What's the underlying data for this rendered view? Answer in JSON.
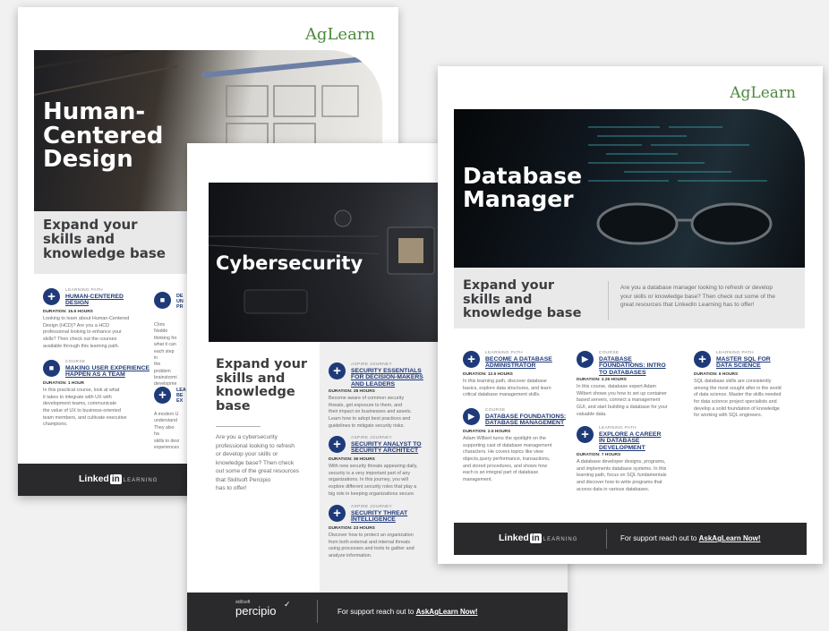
{
  "sheets": {
    "hcd": {
      "brand": "AgLearn",
      "title_lines": [
        "Human-",
        "Centered",
        "Design"
      ],
      "tagline_lines": [
        "Expand your",
        "skills and",
        "knowledge base"
      ],
      "courses": [
        {
          "type": "LEARNING PATH",
          "title_lines": [
            "HUMAN-CENTERED",
            "DESIGN"
          ],
          "duration": "DURATION: 15.5 HOURS",
          "desc_lines": [
            "Looking to learn about Human-Centered",
            "Design (HCD)? Are you a HCD",
            "professional looking to enhance your",
            "skills? Then check out the courses",
            "available through this learning path."
          ]
        },
        {
          "type": "COURSE",
          "title_lines": [
            "MAKING USER EXPERIENCE",
            "HAPPEN AS A TEAM"
          ],
          "duration": "DURATION: 1 HOUR",
          "desc_lines": [
            "In this practical course, look at what",
            "it takes to integrate with UX with",
            "development teams, communicate",
            "the value of UX to business-oriented",
            "team members, and cultivate executive",
            "champions."
          ]
        }
      ],
      "partial_col": {
        "title_lines": [
          "DE",
          "UN",
          "PR"
        ],
        "desc_lines": [
          "Chris Nodde",
          "thinking fro",
          "what it can",
          "each step in",
          "the problem",
          "brainstormi",
          "developme"
        ],
        "title2_lines": [
          "LEA",
          "BE",
          "EX"
        ],
        "desc2_lines": [
          "A modern U",
          "understand",
          "They also ha",
          "skills to desi",
          "experiences"
        ]
      },
      "footer": {
        "linkedin": "Linked",
        "in": "in",
        "learning": "LEARNING"
      }
    },
    "cyber": {
      "title": "Cybersecurity",
      "tagline_lines": [
        "Expand your",
        "skills and",
        "knowledge",
        "base"
      ],
      "intro_lines": [
        "Are you a cybersecurity",
        "professional looking to refresh",
        "or develop your skills or",
        "knowledge base? Then check",
        "out some of the great resources",
        "that Skillsoft Percipio",
        "has to offer!"
      ],
      "courses": [
        {
          "type": "ASPIRE JOURNEY",
          "title_lines": [
            "SECURITY ESSENTIALS",
            "FOR DECISION-MAKERS",
            "AND LEADERS"
          ],
          "duration": "DURATION: 28 HOURS",
          "desc_lines": [
            "Become aware of common security",
            "threats, get exposure to them, and",
            "their impact on businesses and assets.",
            "Learn how to adopt best practices and",
            "guidelines to mitigate security risks."
          ]
        },
        {
          "type": "ASPIRE JOURNEY",
          "title_lines": [
            "SECURITY ANALYST TO",
            "SECURITY ARCHITECT"
          ],
          "duration": "DURATION: 36 HOURS",
          "desc_lines": [
            "With new security threats appearing daily,",
            "security is a very important part of any",
            "organizations. In this journey, you will",
            "explore different security roles that play a",
            "big role in keeping organizations secure."
          ]
        },
        {
          "type": "ASPIRE JOURNEY",
          "title_lines": [
            "SECURITY THREAT",
            "INTELLIGENCE"
          ],
          "duration": "DURATION: 23 HOURS",
          "desc_lines": [
            "Discover how to protect an organization",
            "from both external and internal threats",
            "using processes and tools to gather and",
            "analyze information."
          ]
        }
      ],
      "footer": {
        "skillsoft": "skillsoft",
        "percipio": "percipio",
        "support_prefix": "For support reach out to ",
        "support_link": "AskAgLearn Now!"
      }
    },
    "db": {
      "brand": "AgLearn",
      "title_lines": [
        "Database",
        "Manager"
      ],
      "tagline_lines": [
        "Expand your",
        "skills and",
        "knowledge base"
      ],
      "intro_lines": [
        "Are you a database manager looking to refresh or develop",
        "your skills or knowledge base? Then check out some of the",
        "great resources that LinkedIn Learning has to offer!"
      ],
      "courses": [
        {
          "type": "LEARNING PATH",
          "title_lines": [
            "BECOME A DATABASE",
            "ADMINISTRATOR"
          ],
          "duration": "DURATION: 12.5 HOURS",
          "desc_lines": [
            "In this learning path, discover database",
            "basics, explore data structures, and learn",
            "critical database management skills."
          ]
        },
        {
          "type": "COURSE",
          "title_lines": [
            "DATABASE FOUNDATIONS:",
            "DATABASE MANAGEMENT"
          ],
          "duration": "DURATION: 2.5 HOURS",
          "desc_lines": [
            "Adam Wilbert turns the spotlight on the",
            "supporting cast of database management",
            "characters. He covers topics like view",
            "objects,query performance, transactions,",
            "and stored procedures, and shows how",
            "each is an integral part of database",
            "management."
          ]
        },
        {
          "type": "COURSE",
          "title_lines": [
            "DATABASE",
            "FOUNDATIONS: INTRO",
            "TO DATABASES"
          ],
          "duration": "DURATION: 2.25 HOURS",
          "desc_lines": [
            "In this course, database expert Adam",
            "Wilbert shows you how to set up container",
            "based servers, connect a management",
            "GUI, and start building a database for your",
            "valuable data."
          ]
        },
        {
          "type": "LEARNING PATH",
          "title_lines": [
            "EXPLORE A CAREER",
            "IN DATABASE",
            "DEVELOPMENT"
          ],
          "duration": "DURATION: 7 HOURS",
          "desc_lines": [
            "A database developer designs, programs,",
            "and implements database systems. In this",
            "learning path, focus on SQL fundamentals",
            "and discover how to write programs that",
            "access data in various databases."
          ]
        },
        {
          "type": "LEARNING PATH",
          "title_lines": [
            "MASTER SQL FOR",
            "DATA SCIENCE"
          ],
          "duration": "DURATION: 6 HOURS",
          "desc_lines": [
            "SQL database skills are consistently",
            "among the most sought after in the world",
            "of data science. Master the skills needed",
            "for data science project specialists and",
            "develop a solid foundation of knowledge",
            "for working with SQL engineers."
          ]
        }
      ],
      "footer": {
        "linkedin": "Linked",
        "in": "in",
        "learning": "LEARNING",
        "support_prefix": "For support reach out to ",
        "support_link": "AskAgLearn Now!"
      }
    }
  }
}
